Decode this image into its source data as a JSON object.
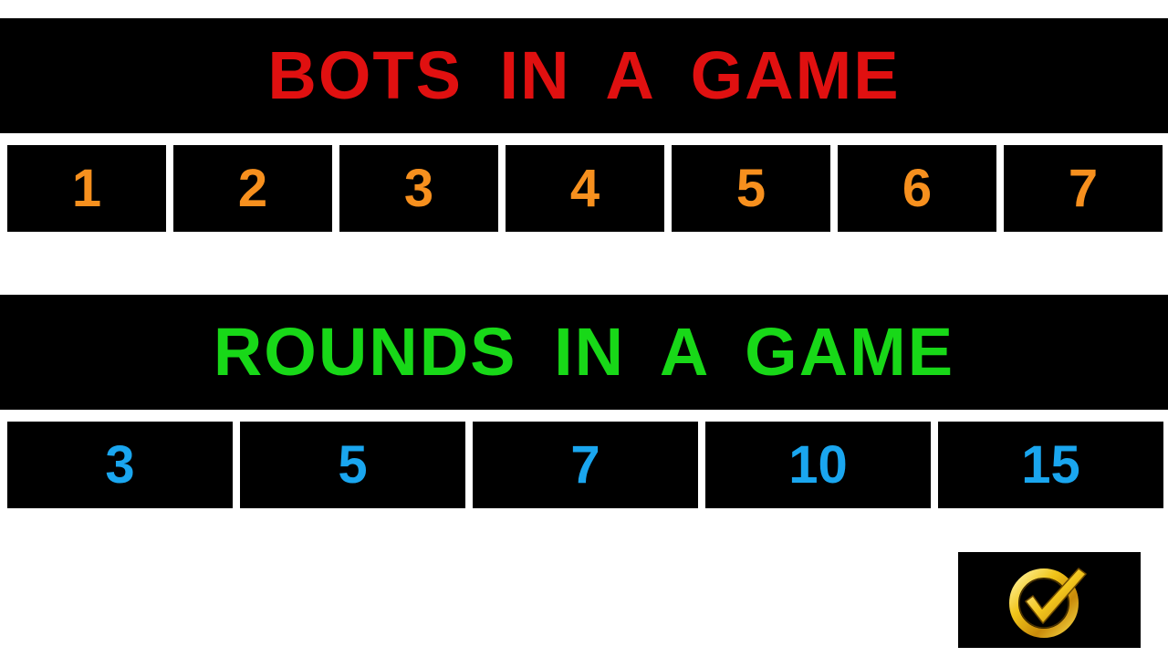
{
  "colors": {
    "background": "#ffffff",
    "panel": "#000000",
    "bots_title": "#e01010",
    "bots_options": "#f7901e",
    "rounds_title": "#18d818",
    "rounds_options": "#1aa6ef",
    "confirm_gold": "#f0c419"
  },
  "bots": {
    "title": "BOTS IN A GAME",
    "options": [
      "1",
      "2",
      "3",
      "4",
      "5",
      "6",
      "7"
    ]
  },
  "rounds": {
    "title": "ROUNDS IN A GAME",
    "options": [
      "3",
      "5",
      "7",
      "10",
      "15"
    ]
  },
  "confirm": {
    "icon": "gold-checkmark-icon"
  }
}
